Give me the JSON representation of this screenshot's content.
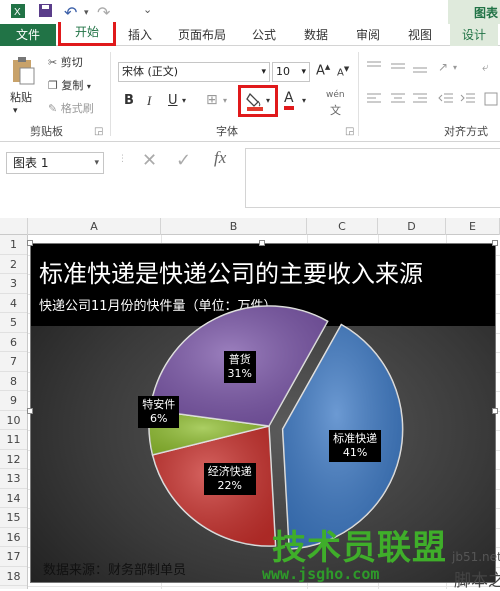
{
  "qat": {
    "undo_arrow": "↶",
    "redo_arrow": "↷",
    "customize": "⌄"
  },
  "context_header": "图表",
  "tabs": {
    "file": "文件",
    "home": "开始",
    "insert": "插入",
    "page_layout": "页面布局",
    "formulas": "公式",
    "data": "数据",
    "review": "审阅",
    "view": "视图",
    "design": "设计"
  },
  "clipboard": {
    "paste": "粘贴",
    "cut": "剪切",
    "copy": "复制",
    "format_painter": "格式刷",
    "group_label": "剪贴板"
  },
  "font": {
    "name": "宋体 (正文)",
    "size": "10",
    "grow": "A",
    "shrink": "A",
    "bold": "B",
    "italic": "I",
    "underline": "U",
    "font_color": "A",
    "phonetic": "wén",
    "group_label": "字体"
  },
  "alignment": {
    "group_label": "对齐方式"
  },
  "formula_bar": {
    "name_box": "图表 1",
    "cancel": "✕",
    "enter": "✓",
    "fx": "fx"
  },
  "columns": [
    "A",
    "B",
    "C",
    "D",
    "E"
  ],
  "rows": [
    "1",
    "2",
    "3",
    "4",
    "5",
    "6",
    "7",
    "8",
    "9",
    "10",
    "11",
    "12",
    "13",
    "14",
    "15",
    "16",
    "17",
    "18"
  ],
  "chart": {
    "title": "标准快递是快递公司的主要收入来源",
    "subtitle": "快递公司11月份的快件量（单位：万件）",
    "source": "数据来源：财务部制单员"
  },
  "chart_data": {
    "type": "pie",
    "title": "标准快递是快递公司的主要收入来源",
    "subtitle": "快递公司11月份的快件量（单位：万件）",
    "categories": [
      "标准快递",
      "经济快递",
      "特安件",
      "普货"
    ],
    "values": [
      41,
      22,
      6,
      31
    ],
    "percent_labels": [
      "41%",
      "22%",
      "6%",
      "31%"
    ],
    "colors": [
      "#3b78c4",
      "#c9302c",
      "#8fbe2f",
      "#7a55a8"
    ],
    "exploded": [
      "标准快递"
    ],
    "legend": "none"
  },
  "watermark": {
    "main": "技术员联盟",
    "url": "www.jsgho.com",
    "site1": "jb51.net",
    "site2": "脚本之家"
  }
}
